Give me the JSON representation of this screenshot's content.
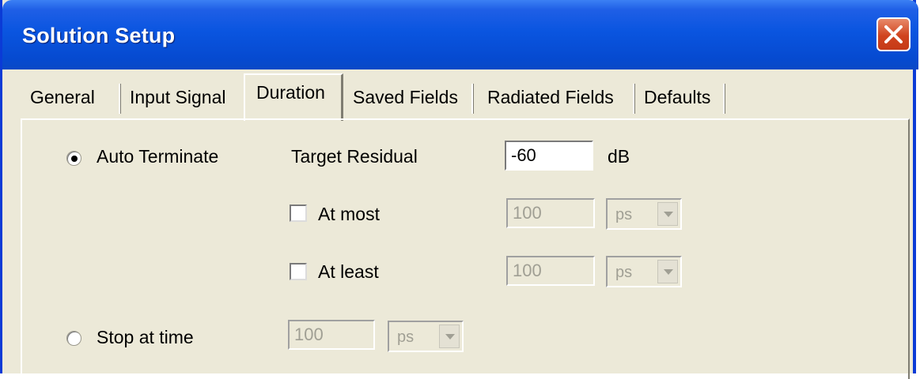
{
  "window": {
    "title": "Solution Setup"
  },
  "tabs": [
    "General",
    "Input Signal",
    "Duration",
    "Saved Fields",
    "Radiated Fields",
    "Defaults"
  ],
  "active_tab": "Duration",
  "duration": {
    "auto_terminate": {
      "label": "Auto Terminate",
      "selected": true
    },
    "target_residual": {
      "label": "Target Residual",
      "value": "-60",
      "unit": "dB"
    },
    "at_most": {
      "label": "At most",
      "checked": false,
      "value": "100",
      "unit": "ps"
    },
    "at_least": {
      "label": "At least",
      "checked": false,
      "value": "100",
      "unit": "ps"
    },
    "stop_at_time": {
      "label": "Stop at time",
      "selected": false,
      "value": "100",
      "unit": "ps"
    }
  },
  "colors": {
    "titlebar": "#0a55e0",
    "dialog_bg": "#ece9d8",
    "close_button": "#d0431e"
  },
  "icons": [
    "close-icon",
    "dropdown-arrow-icon"
  ]
}
